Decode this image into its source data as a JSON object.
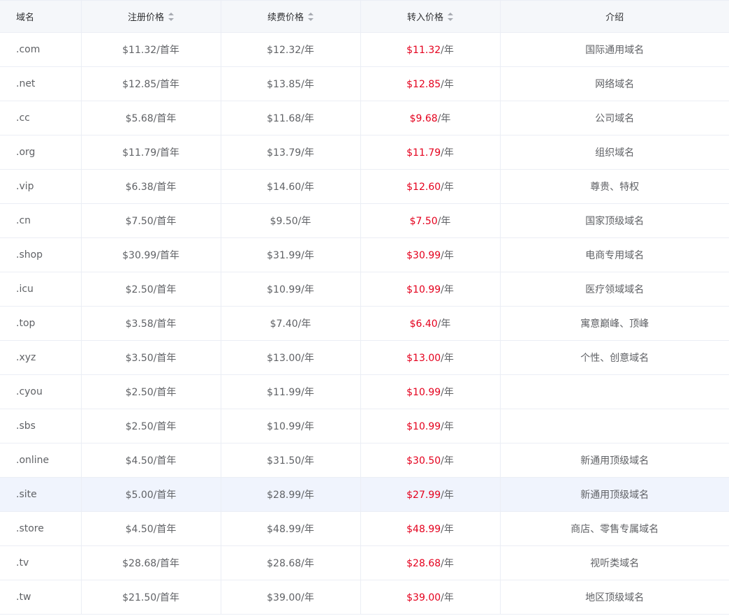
{
  "headers": {
    "domain": "域名",
    "register": "注册价格",
    "renew": "续费价格",
    "transfer": "转入价格",
    "intro": "介绍"
  },
  "colors": {
    "transfer_price": "#e4001d",
    "header_bg": "#f5f7fa",
    "hover_row_bg": "#f0f4fd",
    "border": "#ebeef5"
  },
  "sort_icon": "sort-caret-icon",
  "rows": [
    {
      "domain": ".com",
      "register": "$11.32/首年",
      "renew": "$12.32/年",
      "transfer_price": "$11.32",
      "transfer_unit": "/年",
      "intro": "国际通用域名"
    },
    {
      "domain": ".net",
      "register": "$12.85/首年",
      "renew": "$13.85/年",
      "transfer_price": "$12.85",
      "transfer_unit": "/年",
      "intro": "网络域名"
    },
    {
      "domain": ".cc",
      "register": "$5.68/首年",
      "renew": "$11.68/年",
      "transfer_price": "$9.68",
      "transfer_unit": "/年",
      "intro": "公司域名"
    },
    {
      "domain": ".org",
      "register": "$11.79/首年",
      "renew": "$13.79/年",
      "transfer_price": "$11.79",
      "transfer_unit": "/年",
      "intro": "组织域名"
    },
    {
      "domain": ".vip",
      "register": "$6.38/首年",
      "renew": "$14.60/年",
      "transfer_price": "$12.60",
      "transfer_unit": "/年",
      "intro": "尊贵、特权"
    },
    {
      "domain": ".cn",
      "register": "$7.50/首年",
      "renew": "$9.50/年",
      "transfer_price": "$7.50",
      "transfer_unit": "/年",
      "intro": "国家顶级域名"
    },
    {
      "domain": ".shop",
      "register": "$30.99/首年",
      "renew": "$31.99/年",
      "transfer_price": "$30.99",
      "transfer_unit": "/年",
      "intro": "电商专用域名"
    },
    {
      "domain": ".icu",
      "register": "$2.50/首年",
      "renew": "$10.99/年",
      "transfer_price": "$10.99",
      "transfer_unit": "/年",
      "intro": "医疗领域域名"
    },
    {
      "domain": ".top",
      "register": "$3.58/首年",
      "renew": "$7.40/年",
      "transfer_price": "$6.40",
      "transfer_unit": "/年",
      "intro": "寓意巅峰、顶峰"
    },
    {
      "domain": ".xyz",
      "register": "$3.50/首年",
      "renew": "$13.00/年",
      "transfer_price": "$13.00",
      "transfer_unit": "/年",
      "intro": "个性、创意域名"
    },
    {
      "domain": ".cyou",
      "register": "$2.50/首年",
      "renew": "$11.99/年",
      "transfer_price": "$10.99",
      "transfer_unit": "/年",
      "intro": ""
    },
    {
      "domain": ".sbs",
      "register": "$2.50/首年",
      "renew": "$10.99/年",
      "transfer_price": "$10.99",
      "transfer_unit": "/年",
      "intro": ""
    },
    {
      "domain": ".online",
      "register": "$4.50/首年",
      "renew": "$31.50/年",
      "transfer_price": "$30.50",
      "transfer_unit": "/年",
      "intro": "新通用顶级域名"
    },
    {
      "domain": ".site",
      "register": "$5.00/首年",
      "renew": "$28.99/年",
      "transfer_price": "$27.99",
      "transfer_unit": "/年",
      "intro": "新通用顶级域名"
    },
    {
      "domain": ".store",
      "register": "$4.50/首年",
      "renew": "$48.99/年",
      "transfer_price": "$48.99",
      "transfer_unit": "/年",
      "intro": "商店、零售专属域名"
    },
    {
      "domain": ".tv",
      "register": "$28.68/首年",
      "renew": "$28.68/年",
      "transfer_price": "$28.68",
      "transfer_unit": "/年",
      "intro": "视听类域名"
    },
    {
      "domain": ".tw",
      "register": "$21.50/首年",
      "renew": "$39.00/年",
      "transfer_price": "$39.00",
      "transfer_unit": "/年",
      "intro": "地区顶级域名"
    }
  ],
  "hovered_row_index": 13
}
